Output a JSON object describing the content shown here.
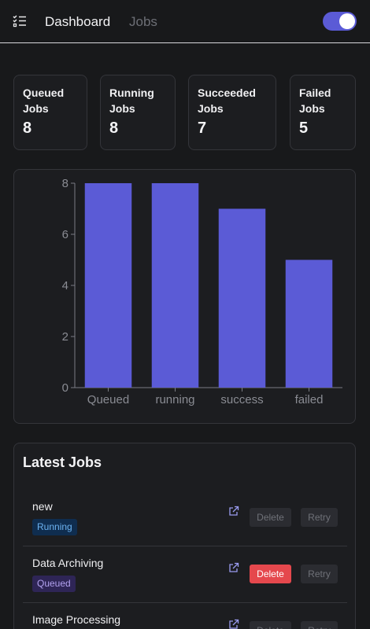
{
  "header": {
    "nav_dashboard": "Dashboard",
    "nav_jobs": "Jobs",
    "theme_toggle_on": true
  },
  "stats": [
    {
      "label": "Queued\nJobs",
      "value": "8"
    },
    {
      "label": "Running\nJobs",
      "value": "8"
    },
    {
      "label": "Succeeded\nJobs",
      "value": "7"
    },
    {
      "label": "Failed\nJobs",
      "value": "5"
    }
  ],
  "chart_data": {
    "type": "bar",
    "categories": [
      "Queued",
      "running",
      "success",
      "failed"
    ],
    "values": [
      8,
      8,
      7,
      5
    ],
    "y_ticks": [
      "0",
      "2",
      "4",
      "6",
      "8"
    ],
    "ylim": [
      0,
      8
    ],
    "bar_color": "#5b5bd6",
    "grid": false
  },
  "latest_jobs": {
    "title": "Latest Jobs",
    "items": [
      {
        "name": "new",
        "status": "Running",
        "delete_label": "Delete",
        "retry_label": "Retry",
        "delete_active": false
      },
      {
        "name": "Data Archiving",
        "status": "Queued",
        "delete_label": "Delete",
        "retry_label": "Retry",
        "delete_active": true
      },
      {
        "name": "Image Processing",
        "status": "",
        "delete_label": "Delete",
        "retry_label": "Retry",
        "delete_active": false
      }
    ]
  },
  "colors": {
    "accent": "#5b5bd6",
    "danger": "#e5484d",
    "background": "#18191b"
  }
}
